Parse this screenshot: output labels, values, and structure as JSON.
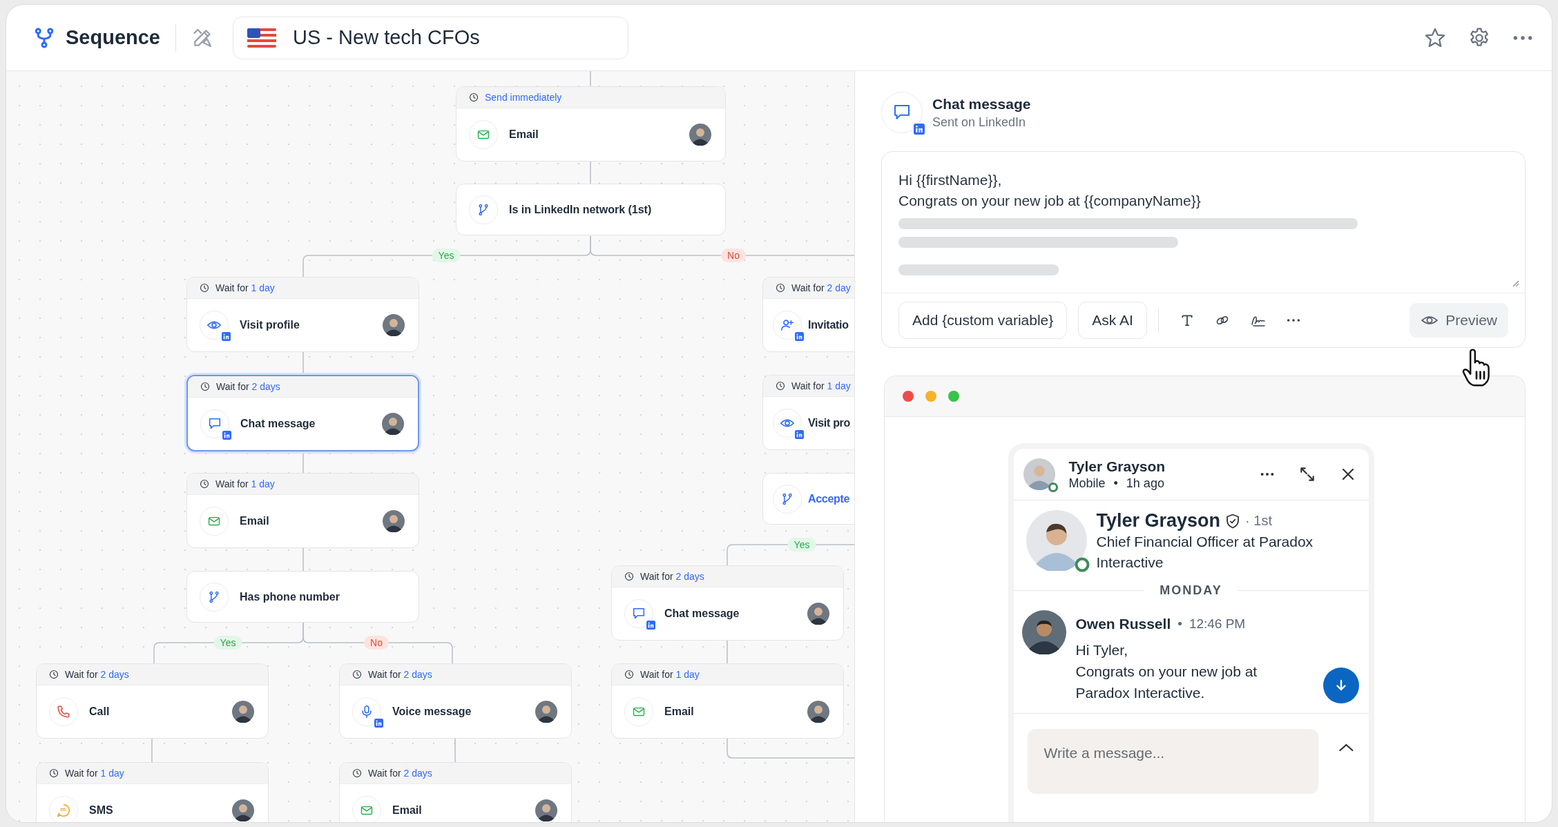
{
  "header": {
    "app_name": "Sequence",
    "sequence_name": "US - New tech CFOs"
  },
  "canvas": {
    "nodes": [
      {
        "kind": "email",
        "wait_value": "Send immediately",
        "linkedin": false,
        "title": "Email",
        "selected": false
      },
      {
        "kind": "condition",
        "title": "Is in LinkedIn network (1st)",
        "highlighted": false,
        "selected": false
      },
      {
        "kind": "view",
        "wait_prefix": "Wait for",
        "wait_value": "1 day",
        "linkedin": true,
        "title": "Visit profile",
        "selected": false
      },
      {
        "kind": "invite",
        "wait_prefix": "Wait for",
        "wait_value": "2 day",
        "linkedin": true,
        "title": "Invitatio",
        "selected": false
      },
      {
        "kind": "chat",
        "wait_prefix": "Wait for",
        "wait_value": "2 days",
        "linkedin": true,
        "title": "Chat message",
        "selected": true
      },
      {
        "kind": "view",
        "wait_prefix": "Wait for",
        "wait_value": "1 day",
        "linkedin": true,
        "title": "Visit pro",
        "selected": false
      },
      {
        "kind": "email",
        "wait_prefix": "Wait for",
        "wait_value": "1 day",
        "linkedin": false,
        "title": "Email",
        "selected": false
      },
      {
        "kind": "condition",
        "title": "Accepte",
        "highlighted": true,
        "selected": false
      },
      {
        "kind": "condition",
        "title": "Has phone number",
        "highlighted": false,
        "selected": false
      },
      {
        "kind": "chat",
        "wait_prefix": "Wait for",
        "wait_value": "2 days",
        "linkedin": true,
        "title": "Chat message",
        "selected": false
      },
      {
        "kind": "call",
        "wait_prefix": "Wait for",
        "wait_value": "2 days",
        "linkedin": false,
        "title": "Call",
        "selected": false
      },
      {
        "kind": "voice",
        "wait_prefix": "Wait for",
        "wait_value": "2 days",
        "linkedin": true,
        "title": "Voice message",
        "selected": false
      },
      {
        "kind": "email",
        "wait_prefix": "Wait for",
        "wait_value": "1 day",
        "linkedin": false,
        "title": "Email",
        "selected": false
      },
      {
        "kind": "sms",
        "wait_prefix": "Wait for",
        "wait_value": "1 day",
        "linkedin": false,
        "title": "SMS",
        "selected": false
      },
      {
        "kind": "email",
        "wait_prefix": "Wait for",
        "wait_value": "2 days",
        "linkedin": false,
        "title": "Email",
        "selected": false
      }
    ],
    "branch_labels": [
      {
        "kind": "yes",
        "text": "Yes"
      },
      {
        "kind": "no",
        "text": "No"
      },
      {
        "kind": "yes",
        "text": "Yes"
      },
      {
        "kind": "yes",
        "text": "Yes"
      },
      {
        "kind": "no",
        "text": "No"
      }
    ]
  },
  "step_detail": {
    "title": "Chat message",
    "subtitle": "Sent on LinkedIn",
    "message_lines": [
      "Hi {{firstName}},",
      "Congrats on your new job at {{companyName}}"
    ],
    "buttons": [
      "Add {custom variable}",
      "Ask AI"
    ],
    "preview_button": "Preview"
  },
  "preview": {
    "contact": {
      "name": "Tyler Grayson",
      "device": "Mobile",
      "separator": "•",
      "last_seen": "1h ago",
      "online": true
    },
    "profile": {
      "name": "Tyler Grayson",
      "verified": true,
      "degree": "· 1st",
      "headline": "Chief Financial Officer at Paradox Interactive"
    },
    "day_label": "MONDAY",
    "message": {
      "sender": "Owen Russell",
      "separator": "•",
      "time": "12:46 PM",
      "lines": [
        "Hi Tyler,",
        "Congrats on your new job at",
        "Paradox Interactive."
      ]
    },
    "composer": {
      "placeholder": "Write a message..."
    }
  }
}
